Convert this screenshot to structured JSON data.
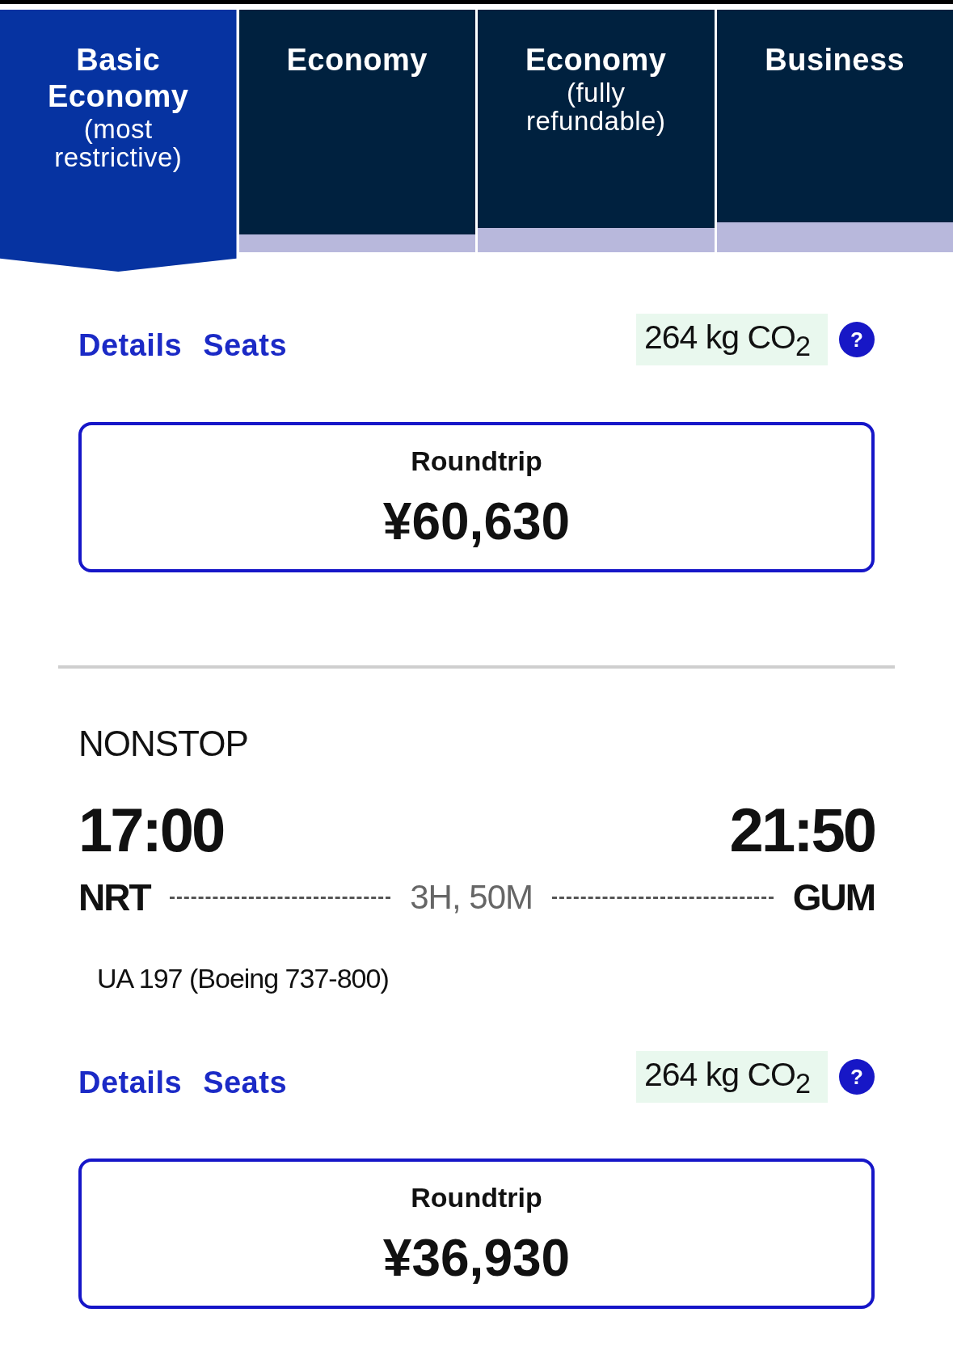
{
  "fare_tabs": [
    {
      "title": "Basic Economy",
      "subtitle": "(most restrictive)",
      "selected": true
    },
    {
      "title": "Economy",
      "selected": false
    },
    {
      "title": "Economy",
      "subtitle": "(fully refundable)",
      "selected": false
    },
    {
      "title": "Business",
      "selected": false
    }
  ],
  "flights": [
    {
      "links": [
        "Details",
        "Seats"
      ],
      "emissions": "264 kg CO$_{2}$",
      "help": "?",
      "fare": {
        "label": "Roundtrip",
        "price": "¥60,630"
      }
    },
    {
      "stops": "NONSTOP",
      "depart_time": "17:00",
      "arrive_time": "21:50",
      "origin": "NRT",
      "destination": "GUM",
      "duration": "3H, 50M",
      "flight_info": "UA 197 (Boeing 737-800)",
      "links": [
        "Details",
        "Seats"
      ],
      "emissions": "264 kg CO$_{2}$",
      "help": "?",
      "fare": {
        "label": "Roundtrip",
        "price": "¥36,930"
      }
    }
  ]
}
